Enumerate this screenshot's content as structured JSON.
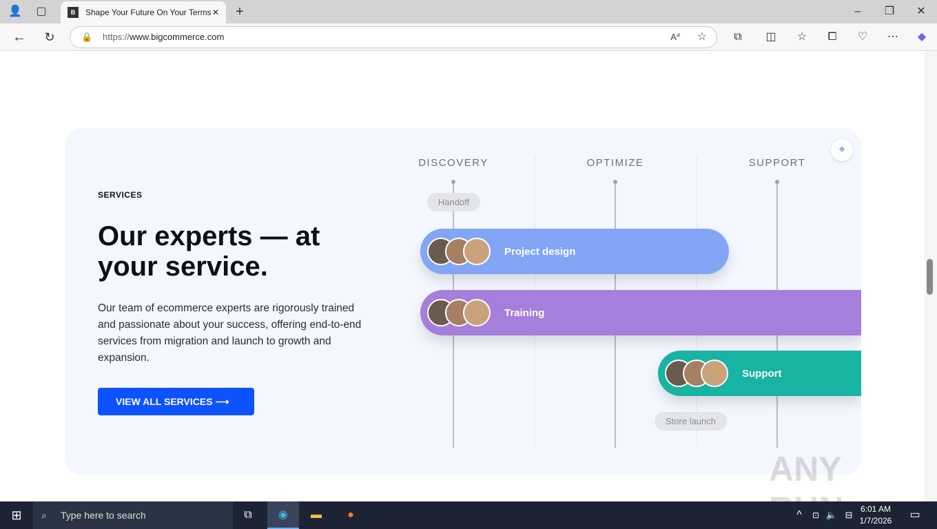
{
  "browser": {
    "tab_title": "Shape Your Future On Your Terms",
    "url_prefix": "https://",
    "url_host": "www.bigcommerce.com"
  },
  "hero": {
    "eyebrow": "SERVICES",
    "title": "Our experts — at your service.",
    "body": "Our team of ecommerce experts are rigorously trained and passionate about your success, offering end-to-end services from migration and launch to growth and expansion.",
    "cta": "VIEW ALL SERVICES"
  },
  "timeline": {
    "columns": [
      "DISCOVERY",
      "OPTIMIZE",
      "SUPPORT"
    ],
    "milestones": [
      "Handoff",
      "Store launch"
    ],
    "bars": [
      {
        "label": "Project design",
        "color": "#82a6f5"
      },
      {
        "label": "Training",
        "color": "#a57fdc"
      },
      {
        "label": "Support",
        "color": "#17b3a3"
      }
    ]
  },
  "taskbar": {
    "search_placeholder": "Type here to search",
    "time": "6:01 AM",
    "date": "1/7/2026"
  },
  "watermark": "ANY RUN"
}
